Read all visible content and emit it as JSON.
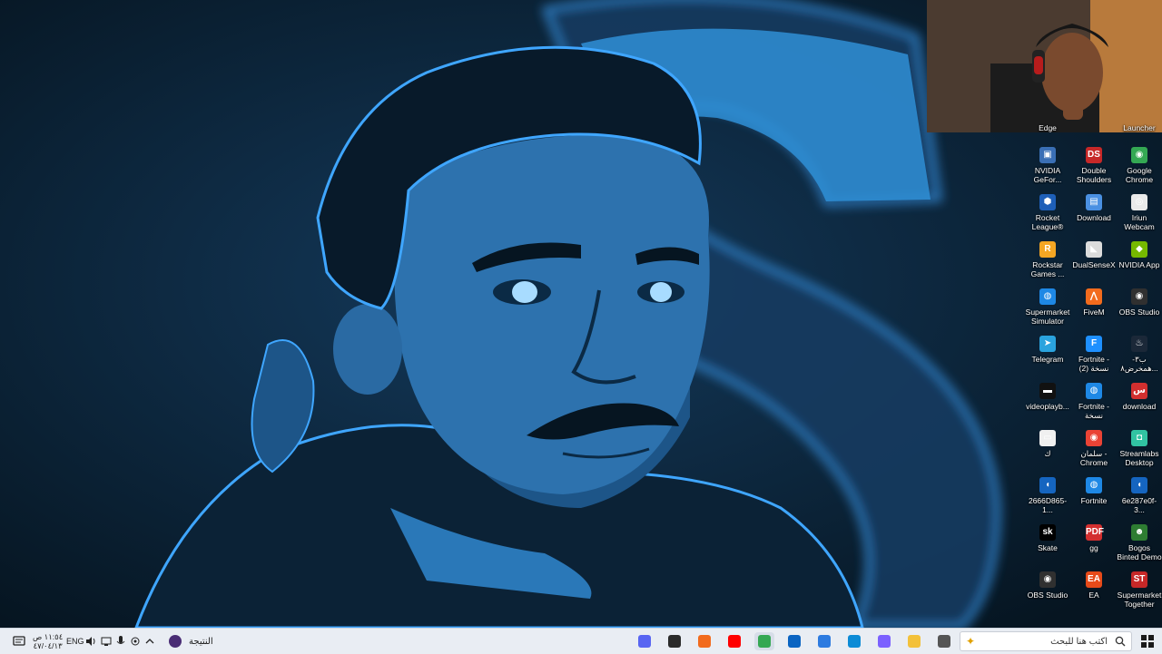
{
  "desktop": {
    "icons": [
      {
        "label": "NVIDIA GeFor...",
        "glyph": "▣",
        "color": "#3a6fb5"
      },
      {
        "label": "Double Shoulders",
        "glyph": "DS",
        "color": "#c62828"
      },
      {
        "label": "Google Chrome",
        "glyph": "◉",
        "color": "#34a853"
      },
      {
        "label": "Rocket League®",
        "glyph": "⬢",
        "color": "#1e5fb8"
      },
      {
        "label": "Download",
        "glyph": "▤",
        "color": "#4a90e2"
      },
      {
        "label": "Iriun Webcam",
        "glyph": "◎",
        "color": "#eaeaea"
      },
      {
        "label": "Rockstar Games ...",
        "glyph": "R",
        "color": "#f5a623"
      },
      {
        "label": "DualSenseX",
        "glyph": "◣",
        "color": "#dcdcdc"
      },
      {
        "label": "NVIDIA App",
        "glyph": "◆",
        "color": "#76b900"
      },
      {
        "label": "Supermarket Simulator",
        "glyph": "◍",
        "color": "#1e88e5"
      },
      {
        "label": "FiveM",
        "glyph": "⋀",
        "color": "#f26b1d"
      },
      {
        "label": "OBS Studio",
        "glyph": "◉",
        "color": "#303030"
      },
      {
        "label": "Telegram",
        "glyph": "➤",
        "color": "#2aa3de"
      },
      {
        "label": "Fortnite - نسخة (2)",
        "glyph": "F",
        "color": "#1e90ff"
      },
      {
        "label": "ب٣-همخرض٨...",
        "glyph": "♨",
        "color": "#1b2838"
      },
      {
        "label": "videoplayb...",
        "glyph": "▬",
        "color": "#111111"
      },
      {
        "label": "Fortnite - نسخة",
        "glyph": "◍",
        "color": "#1e88e5"
      },
      {
        "label": "download",
        "glyph": "س",
        "color": "#d32f2f"
      },
      {
        "label": "ك",
        "glyph": "▭",
        "color": "#f0f0f0"
      },
      {
        "label": "سلمان - Chrome",
        "glyph": "◉",
        "color": "#ea4335"
      },
      {
        "label": "Streamlabs Desktop",
        "glyph": "◘",
        "color": "#31c3a2"
      },
      {
        "label": "2666D865-1...",
        "glyph": "◖",
        "color": "#1565c0"
      },
      {
        "label": "Fortnite",
        "glyph": "◍",
        "color": "#1e88e5"
      },
      {
        "label": "6e287e0f-3...",
        "glyph": "◖",
        "color": "#1565c0"
      },
      {
        "label": "Skate",
        "glyph": "sk",
        "color": "#000000"
      },
      {
        "label": "gg",
        "glyph": "PDF",
        "color": "#d32f2f"
      },
      {
        "label": "Bogos Binted Demo",
        "glyph": "☻",
        "color": "#2e7d32"
      },
      {
        "label": "OBS Studio",
        "glyph": "◉",
        "color": "#303030"
      },
      {
        "label": "EA",
        "glyph": "EA",
        "color": "#e64a19"
      },
      {
        "label": "Supermarket Together",
        "glyph": "ST",
        "color": "#c62828"
      }
    ],
    "partial_labels": {
      "left": "Edge",
      "right": "Launcher"
    }
  },
  "taskbar": {
    "start_icon": "windows-icon",
    "search": {
      "placeholder": "اكتب هنا للبحث"
    },
    "weather_label": "النتيجة",
    "clock": {
      "time": "١١:٥٤ ص",
      "date": "٤٧/٠٤/١٣"
    },
    "language": "ENG",
    "apps": [
      {
        "name": "task-view-icon",
        "color": "#555555"
      },
      {
        "name": "file-explorer-icon",
        "color": "#f3c13a"
      },
      {
        "name": "copilot-icon",
        "color": "#7b61ff"
      },
      {
        "name": "edge-icon",
        "color": "#0c8bd6"
      },
      {
        "name": "store-icon",
        "color": "#2d7be0"
      },
      {
        "name": "outlook-icon",
        "color": "#0a64c2"
      },
      {
        "name": "chrome-icon",
        "color": "#34a853"
      },
      {
        "name": "youtube-icon",
        "color": "#ff0000"
      },
      {
        "name": "fivem-icon",
        "color": "#f26b1d"
      },
      {
        "name": "obs-icon",
        "color": "#2b2b2b"
      },
      {
        "name": "discord-icon",
        "color": "#5865f2"
      }
    ]
  }
}
